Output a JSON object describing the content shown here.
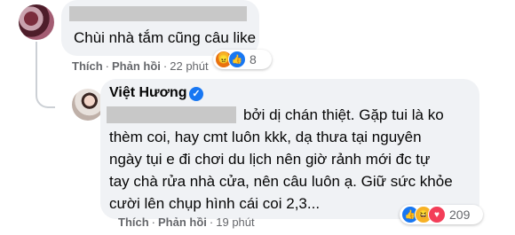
{
  "comment1": {
    "text": "Chùi nhà tắm cũng câu like",
    "actions": {
      "like": "Thích",
      "reply": "Phản hồi",
      "time": "22 phút"
    },
    "reactions": {
      "icons": [
        "angry-icon",
        "like-icon"
      ],
      "count": "8"
    }
  },
  "comment2": {
    "author": "Việt Hương",
    "verified_icon": "check-icon",
    "line1": "bởi dị chán thiệt. Gặp tui là ko",
    "lines": [
      "thèm coi, hay cmt luôn kkk, dạ thưa tại nguyên",
      "ngày tụi e đi chơi du lịch nên giờ rảnh mới đc tự",
      "tay chà rửa nhà cửa, nên câu luôn ạ. Giữ sức khỏe",
      "cười lên chụp hình cái coi 2,3..."
    ],
    "actions": {
      "like": "Thích",
      "reply": "Phản hồi",
      "time": "19 phút"
    },
    "reactions": {
      "icons": [
        "like-icon",
        "haha-icon",
        "love-icon"
      ],
      "count": "209"
    }
  },
  "colors": {
    "bubble": "#f0f2f5",
    "link_blue": "#1877f2",
    "meta_gray": "#65676b"
  }
}
